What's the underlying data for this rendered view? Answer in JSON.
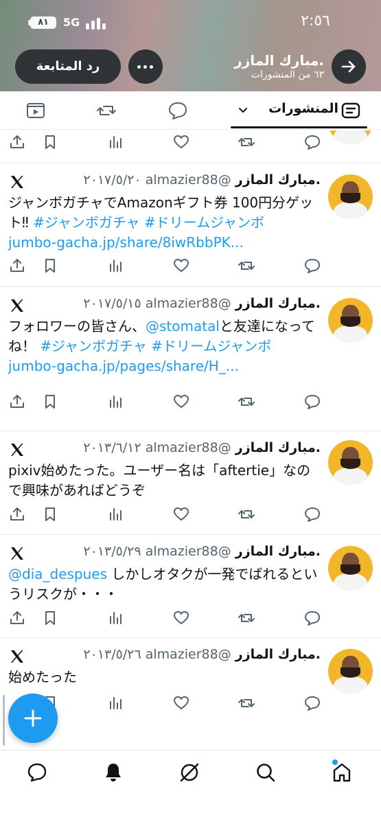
{
  "status_bar": {
    "battery": "٨١",
    "network": "5G",
    "time": "٢:٥٦"
  },
  "profile": {
    "name": ".مبارك المازر",
    "posts_count": "٦٣ من المنشورات",
    "follow_back_label": "رد المتابعة"
  },
  "tabs": {
    "posts_label": "المنشورات"
  },
  "tweets": [
    {
      "name": ".مبارك المازر",
      "handle": "@almazier88",
      "date": "٢٠١٧/٥/٢٠",
      "text": "ジャンボガチャでAmazonギフト券 100円分ゲット‼ ",
      "hashtags": "#ジャンボガチャ #ドリームジャンボ",
      "link": "jumbo-gacha.jp/share/8iwRbbPK..."
    },
    {
      "name": ".مبارك المازر",
      "handle": "@almazier88",
      "date": "٢٠١٧/٥/١٥",
      "text_pre": "フォロワーの皆さん、",
      "mention": "@stomatal",
      "text_post": "と友達になってね！ ",
      "hashtags": "#ジャンボガチャ #ドリームジャンボ",
      "link": "jumbo-gacha.jp/pages/share/H_..."
    },
    {
      "name": ".مبارك المازر",
      "handle": "@almazier88",
      "date": "٢٠١٣/٦/١٢",
      "text": "pixiv始めたった。ユーザー名は「aftertie」なので興味があればどうぞ"
    },
    {
      "name": ".مبارك المازر",
      "handle": "@almazier88",
      "date": "٢٠١٣/٥/٢٩",
      "mention": "@dia_despues",
      "text": " しかしオタクが一発でばれるというリスクが・・・"
    },
    {
      "name": ".مبارك المازر",
      "handle": "@almazier88",
      "date": "٢٠١٣/٥/٢٦",
      "text": "始めたった"
    }
  ],
  "icons": {
    "tab_icons": [
      "video-icon",
      "repost-icon",
      "reply-icon",
      "posts-icon"
    ],
    "action_icons": [
      "share-icon",
      "bookmark-icon",
      "views-icon",
      "like-icon",
      "repost-icon",
      "reply-icon"
    ],
    "nav_icons": [
      "messages-icon",
      "notifications-icon",
      "grok-icon",
      "search-icon",
      "home-icon"
    ]
  },
  "colors": {
    "accent": "#1d9bf0",
    "text": "#0f1419",
    "secondary_text": "#536471"
  }
}
